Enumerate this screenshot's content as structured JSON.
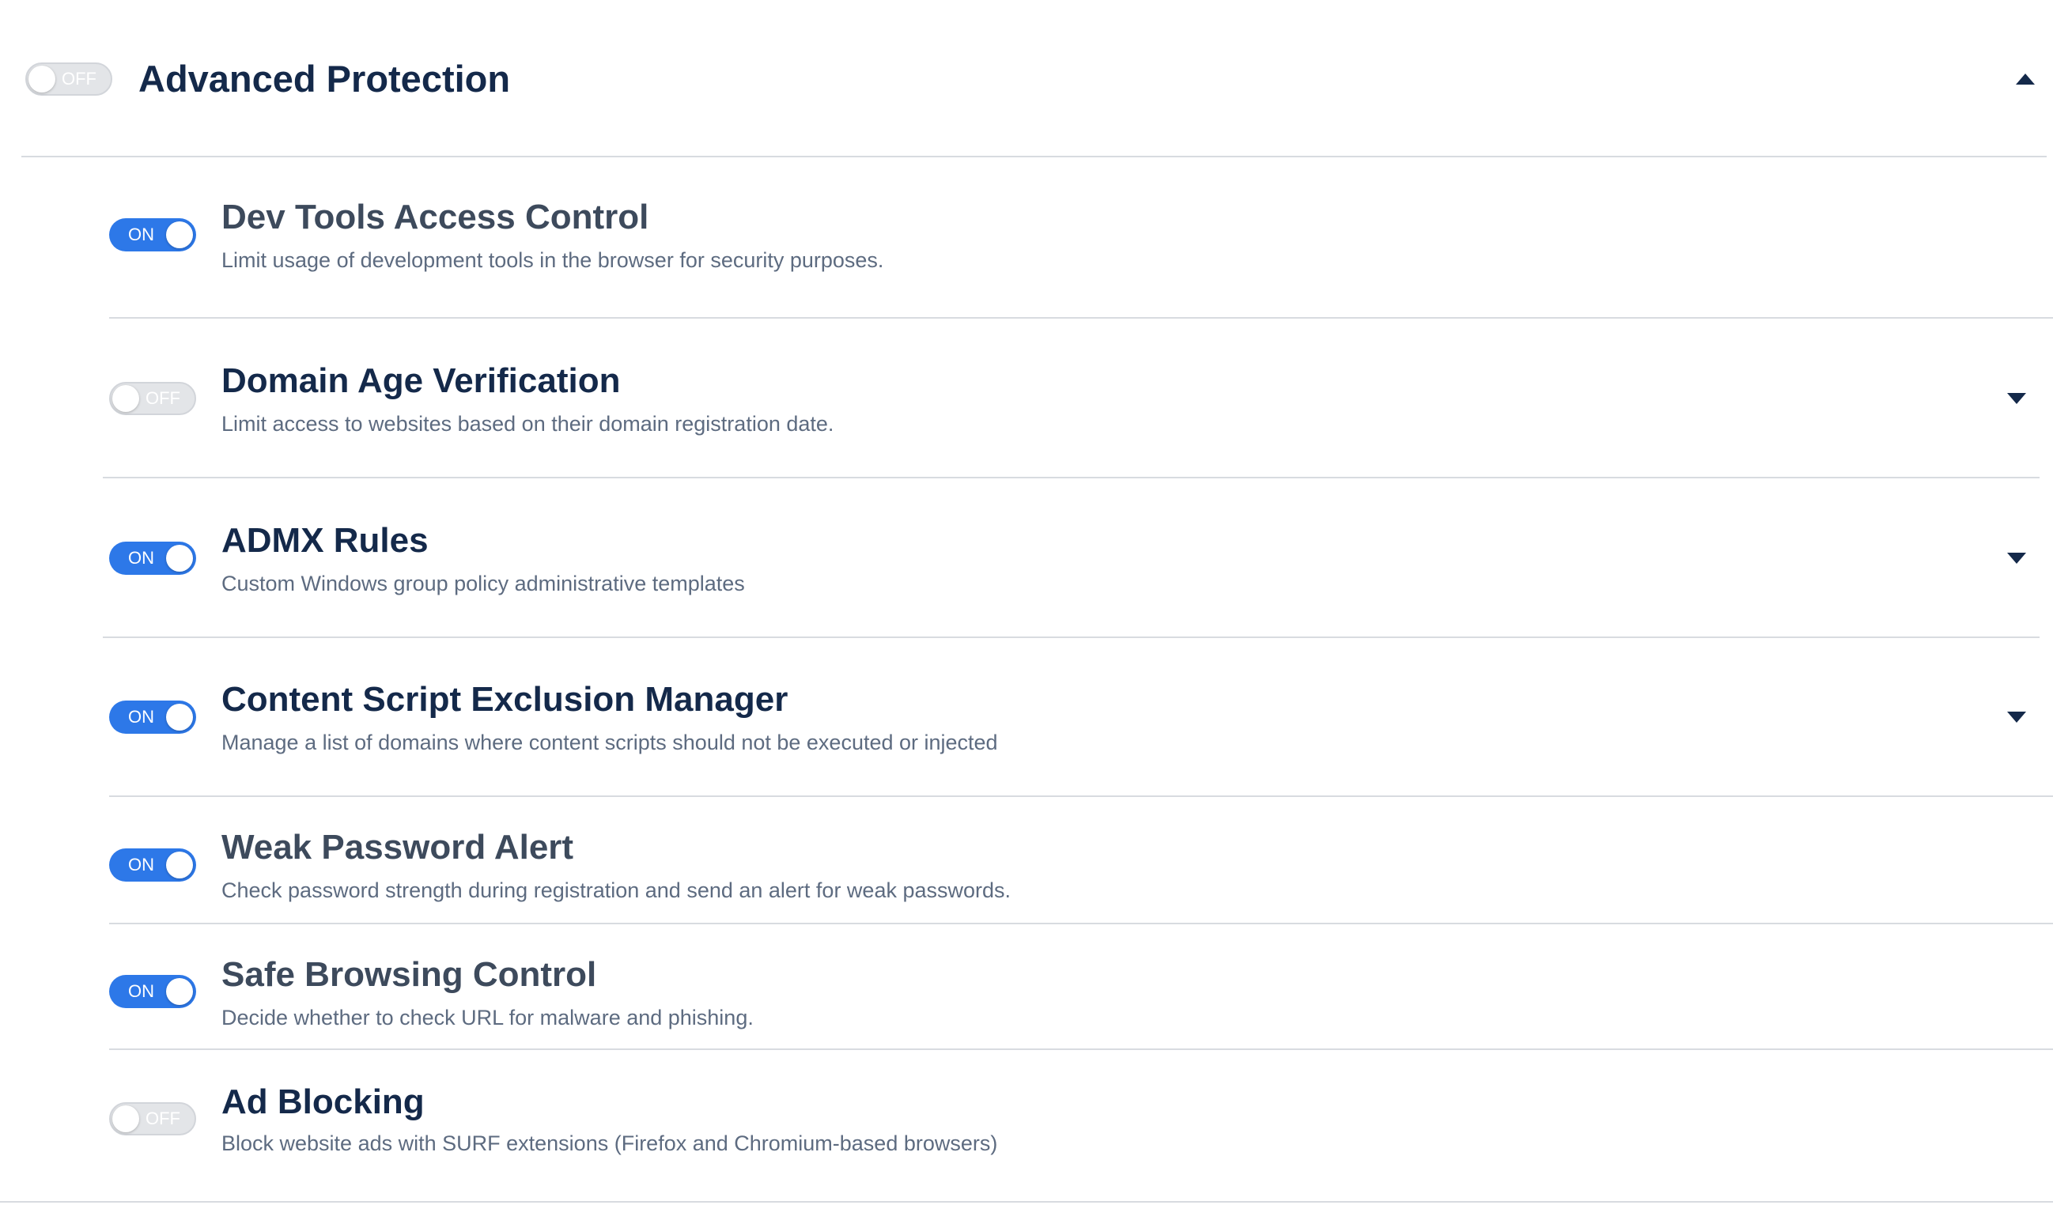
{
  "section": {
    "title": "Advanced Protection",
    "toggle_state": "OFF",
    "expand_icon": "caret-up-icon"
  },
  "toggle_labels": {
    "on": "ON",
    "off": "OFF"
  },
  "colors": {
    "title": "#14294a",
    "accent": "#2d78e8",
    "off_track": "#e3e5e8",
    "description": "#5d6b80",
    "divider": "#d8dbe0"
  },
  "items": [
    {
      "title": "Dev Tools Access Control",
      "description": "Limit usage of development tools in the browser for security purposes.",
      "state": "ON",
      "expandable": false
    },
    {
      "title": "Domain Age Verification",
      "description": "Limit access to websites based on their domain registration date.",
      "state": "OFF",
      "expandable": true
    },
    {
      "title": "ADMX Rules",
      "description": "Custom Windows group policy administrative templates",
      "state": "ON",
      "expandable": true
    },
    {
      "title": "Content Script Exclusion Manager",
      "description": "Manage a list of domains where content scripts should not be executed or injected",
      "state": "ON",
      "expandable": true
    },
    {
      "title": "Weak Password Alert",
      "description": "Check password strength during registration and send an alert for weak passwords.",
      "state": "ON",
      "expandable": false
    },
    {
      "title": "Safe Browsing Control",
      "description": "Decide whether to check URL for malware and phishing.",
      "state": "ON",
      "expandable": false
    },
    {
      "title": "Ad Blocking",
      "description": "Block website ads with SURF extensions (Firefox and Chromium-based browsers)",
      "state": "OFF",
      "expandable": false
    }
  ]
}
